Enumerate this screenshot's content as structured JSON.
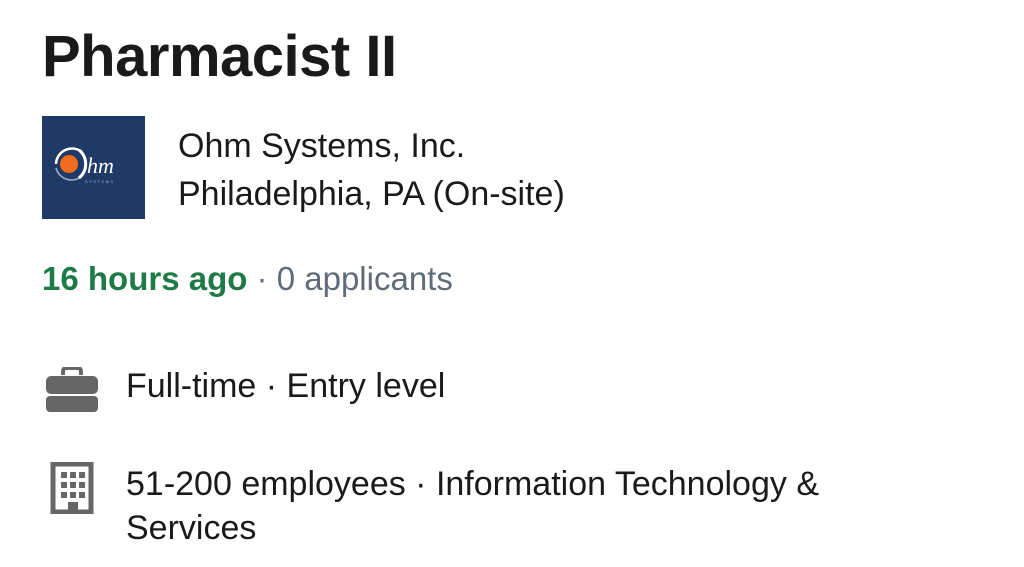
{
  "job": {
    "title": "Pharmacist II"
  },
  "company": {
    "name": "Ohm Systems, Inc.",
    "location": "Philadelphia, PA (On-site)",
    "logo_text": "hm",
    "logo_subtext": "SYSTEMS",
    "logo_bg_color": "#1f3a66",
    "logo_accent_color": "#f26b21"
  },
  "meta": {
    "posted": "16 hours ago",
    "separator": " · ",
    "applicants": "0 applicants",
    "posted_color": "#1e7a46"
  },
  "details": {
    "job_type": {
      "icon": "briefcase-icon",
      "text": "Full-time · Entry level"
    },
    "company_size": {
      "icon": "building-icon",
      "text": "51-200 employees · Information Technology & Services"
    }
  }
}
